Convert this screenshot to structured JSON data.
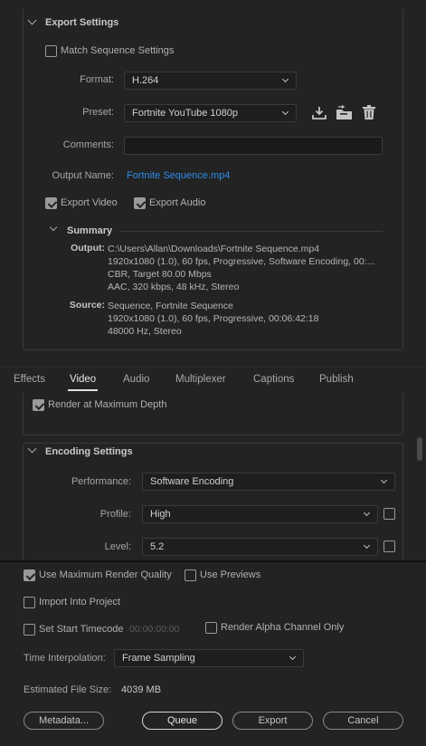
{
  "export_settings": {
    "title": "Export Settings",
    "match_sequence": {
      "label": "Match Sequence Settings",
      "checked": false
    },
    "format": {
      "label": "Format:",
      "value": "H.264"
    },
    "preset": {
      "label": "Preset:",
      "value": "Fortnite YouTube 1080p"
    },
    "comments": {
      "label": "Comments:",
      "value": ""
    },
    "output_name": {
      "label": "Output Name:",
      "value": "Fortnite Sequence.mp4"
    },
    "export_video": {
      "label": "Export Video",
      "checked": true
    },
    "export_audio": {
      "label": "Export Audio",
      "checked": true
    },
    "summary": {
      "title": "Summary",
      "output_label": "Output:",
      "output_lines": [
        "C:\\Users\\Allan\\Downloads\\Fortnite Sequence.mp4",
        "1920x1080 (1.0), 60 fps, Progressive, Software Encoding, 00:...",
        "CBR, Target 80.00 Mbps",
        "AAC, 320 kbps, 48 kHz, Stereo"
      ],
      "source_label": "Source:",
      "source_lines": [
        "Sequence, Fortnite Sequence",
        "1920x1080 (1.0), 60 fps, Progressive, 00:06:42:18",
        "48000 Hz, Stereo"
      ]
    }
  },
  "tabs": [
    {
      "label": "Effects",
      "active": false
    },
    {
      "label": "Video",
      "active": true
    },
    {
      "label": "Audio",
      "active": false
    },
    {
      "label": "Multiplexer",
      "active": false
    },
    {
      "label": "Captions",
      "active": false
    },
    {
      "label": "Publish",
      "active": false
    }
  ],
  "video": {
    "render_max_depth": {
      "label": "Render at Maximum Depth",
      "checked": true
    },
    "encoding": {
      "title": "Encoding Settings",
      "performance": {
        "label": "Performance:",
        "value": "Software Encoding"
      },
      "profile": {
        "label": "Profile:",
        "value": "High",
        "checked": false
      },
      "level": {
        "label": "Level:",
        "value": "5.2",
        "checked": false
      }
    }
  },
  "bottom": {
    "max_render_quality": {
      "label": "Use Maximum Render Quality",
      "checked": true
    },
    "use_previews": {
      "label": "Use Previews",
      "checked": false
    },
    "import_into_project": {
      "label": "Import Into Project",
      "checked": false
    },
    "set_start_timecode": {
      "label": "Set Start Timecode",
      "checked": false,
      "timecode": "00:00:00:00"
    },
    "render_alpha": {
      "label": "Render Alpha Channel Only",
      "checked": false
    },
    "time_interpolation": {
      "label": "Time Interpolation:",
      "value": "Frame Sampling"
    },
    "estimated_file_size": {
      "label": "Estimated File Size:",
      "value": "4039 MB"
    },
    "buttons": {
      "metadata": "Metadata...",
      "queue": "Queue",
      "export": "Export",
      "cancel": "Cancel"
    }
  },
  "icons": [
    "save-preset-icon",
    "import-preset-icon",
    "delete-preset-icon",
    "chevron-down-icon"
  ],
  "colors": {
    "accent_link": "#2d8ceb",
    "background": "#232323",
    "field": "#1e1e1e"
  }
}
